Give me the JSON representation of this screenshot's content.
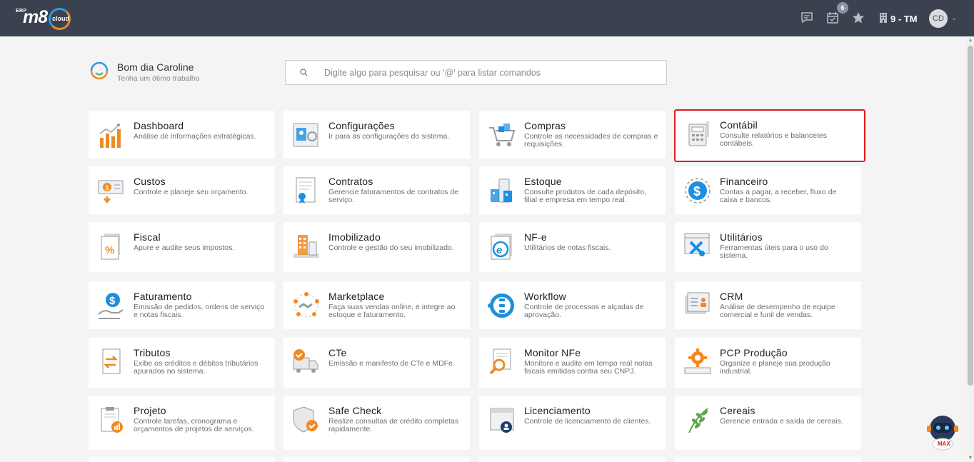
{
  "topbar": {
    "logo_erp": "ERP",
    "logo_m8": "m8",
    "logo_cloud": "cloud",
    "notif_count": "6",
    "company": "9 - TM",
    "avatar_initials": "CD"
  },
  "greeting": {
    "title": "Bom dia Caroline",
    "subtitle": "Tenha um ótimo trabalho"
  },
  "search": {
    "placeholder": "Digite algo para pesquisar ou '@' para listar comandos"
  },
  "modules": [
    {
      "title": "Dashboard",
      "desc": "Análise de informações estratégicas.",
      "icon": "chart-icon"
    },
    {
      "title": "Configurações",
      "desc": "Ir para as configurações do sistema.",
      "icon": "settings-panel-icon"
    },
    {
      "title": "Compras",
      "desc": "Controle as necessidades de compras e requisições.",
      "icon": "cart-icon"
    },
    {
      "title": "Contábil",
      "desc": "Consulte relatórios e balancetes contábeis.",
      "icon": "calculator-icon"
    },
    {
      "title": "Custos",
      "desc": "Controle e planeje seu orçamento.",
      "icon": "money-icon"
    },
    {
      "title": "Contratos",
      "desc": "Gerencie faturamentos de contratos de serviço.",
      "icon": "contract-icon"
    },
    {
      "title": "Estoque",
      "desc": "Consulte produtos de cada depósito, filial e empresa em tempo real.",
      "icon": "warehouse-icon"
    },
    {
      "title": "Financeiro",
      "desc": "Contas a pagar, a receber, fluxo de caixa e bancos.",
      "icon": "dollar-circle-icon"
    },
    {
      "title": "Fiscal",
      "desc": "Apure e audite seus impostos.",
      "icon": "tax-document-icon"
    },
    {
      "title": "Imobilizado",
      "desc": "Controle e gestão do seu imobilizado.",
      "icon": "building-icon"
    },
    {
      "title": "NF-e",
      "desc": "Utilitários de notas fiscais.",
      "icon": "e-document-icon"
    },
    {
      "title": "Utilitários",
      "desc": "Ferramentas úteis para o uso do sistema.",
      "icon": "tools-icon"
    },
    {
      "title": "Faturamento",
      "desc": "Emissão de pedidos, ordens de serviço e notas fiscais.",
      "icon": "billing-hand-icon"
    },
    {
      "title": "Marketplace",
      "desc": "Faça suas vendas online, e integre ao estoque e faturamento.",
      "icon": "handshake-icon"
    },
    {
      "title": "Workflow",
      "desc": "Controle de processos e alçadas de aprovação.",
      "icon": "workflow-icon"
    },
    {
      "title": "CRM",
      "desc": "Análise de desempenho de equipe comercial e funil de vendas.",
      "icon": "contacts-icon"
    },
    {
      "title": "Tributos",
      "desc": "Exibe os créditos e débitos tributários apurados no sistema.",
      "icon": "exchange-document-icon"
    },
    {
      "title": "CTe",
      "desc": "Emissão e manifesto de CTe e MDFe.",
      "icon": "truck-icon"
    },
    {
      "title": "Monitor NFe",
      "desc": "Monitore e audite em tempo real notas fiscais emitidas contra seu CNPJ.",
      "icon": "magnifier-document-icon"
    },
    {
      "title": "PCP Produção",
      "desc": "Organize e planeje sua produção industrial.",
      "icon": "gear-production-icon"
    },
    {
      "title": "Projeto",
      "desc": "Controle tarefas, cronograma e orçamentos de projetos de serviços.",
      "icon": "clipboard-chart-icon"
    },
    {
      "title": "Safe Check",
      "desc": "Realize consultas de crédito completas rapidamente.",
      "icon": "shield-check-icon"
    },
    {
      "title": "Licenciamento",
      "desc": "Controle de licenciamento de clientes.",
      "icon": "license-icon"
    },
    {
      "title": "Cereais",
      "desc": "Gerencie entrada e saída de cereais.",
      "icon": "plant-icon"
    }
  ],
  "assistant": {
    "label": "MAX"
  },
  "colors": {
    "topbar": "#3c4150",
    "accent_orange": "#f08a24",
    "accent_blue": "#1c8fe0",
    "highlight": "#e01d1d"
  }
}
